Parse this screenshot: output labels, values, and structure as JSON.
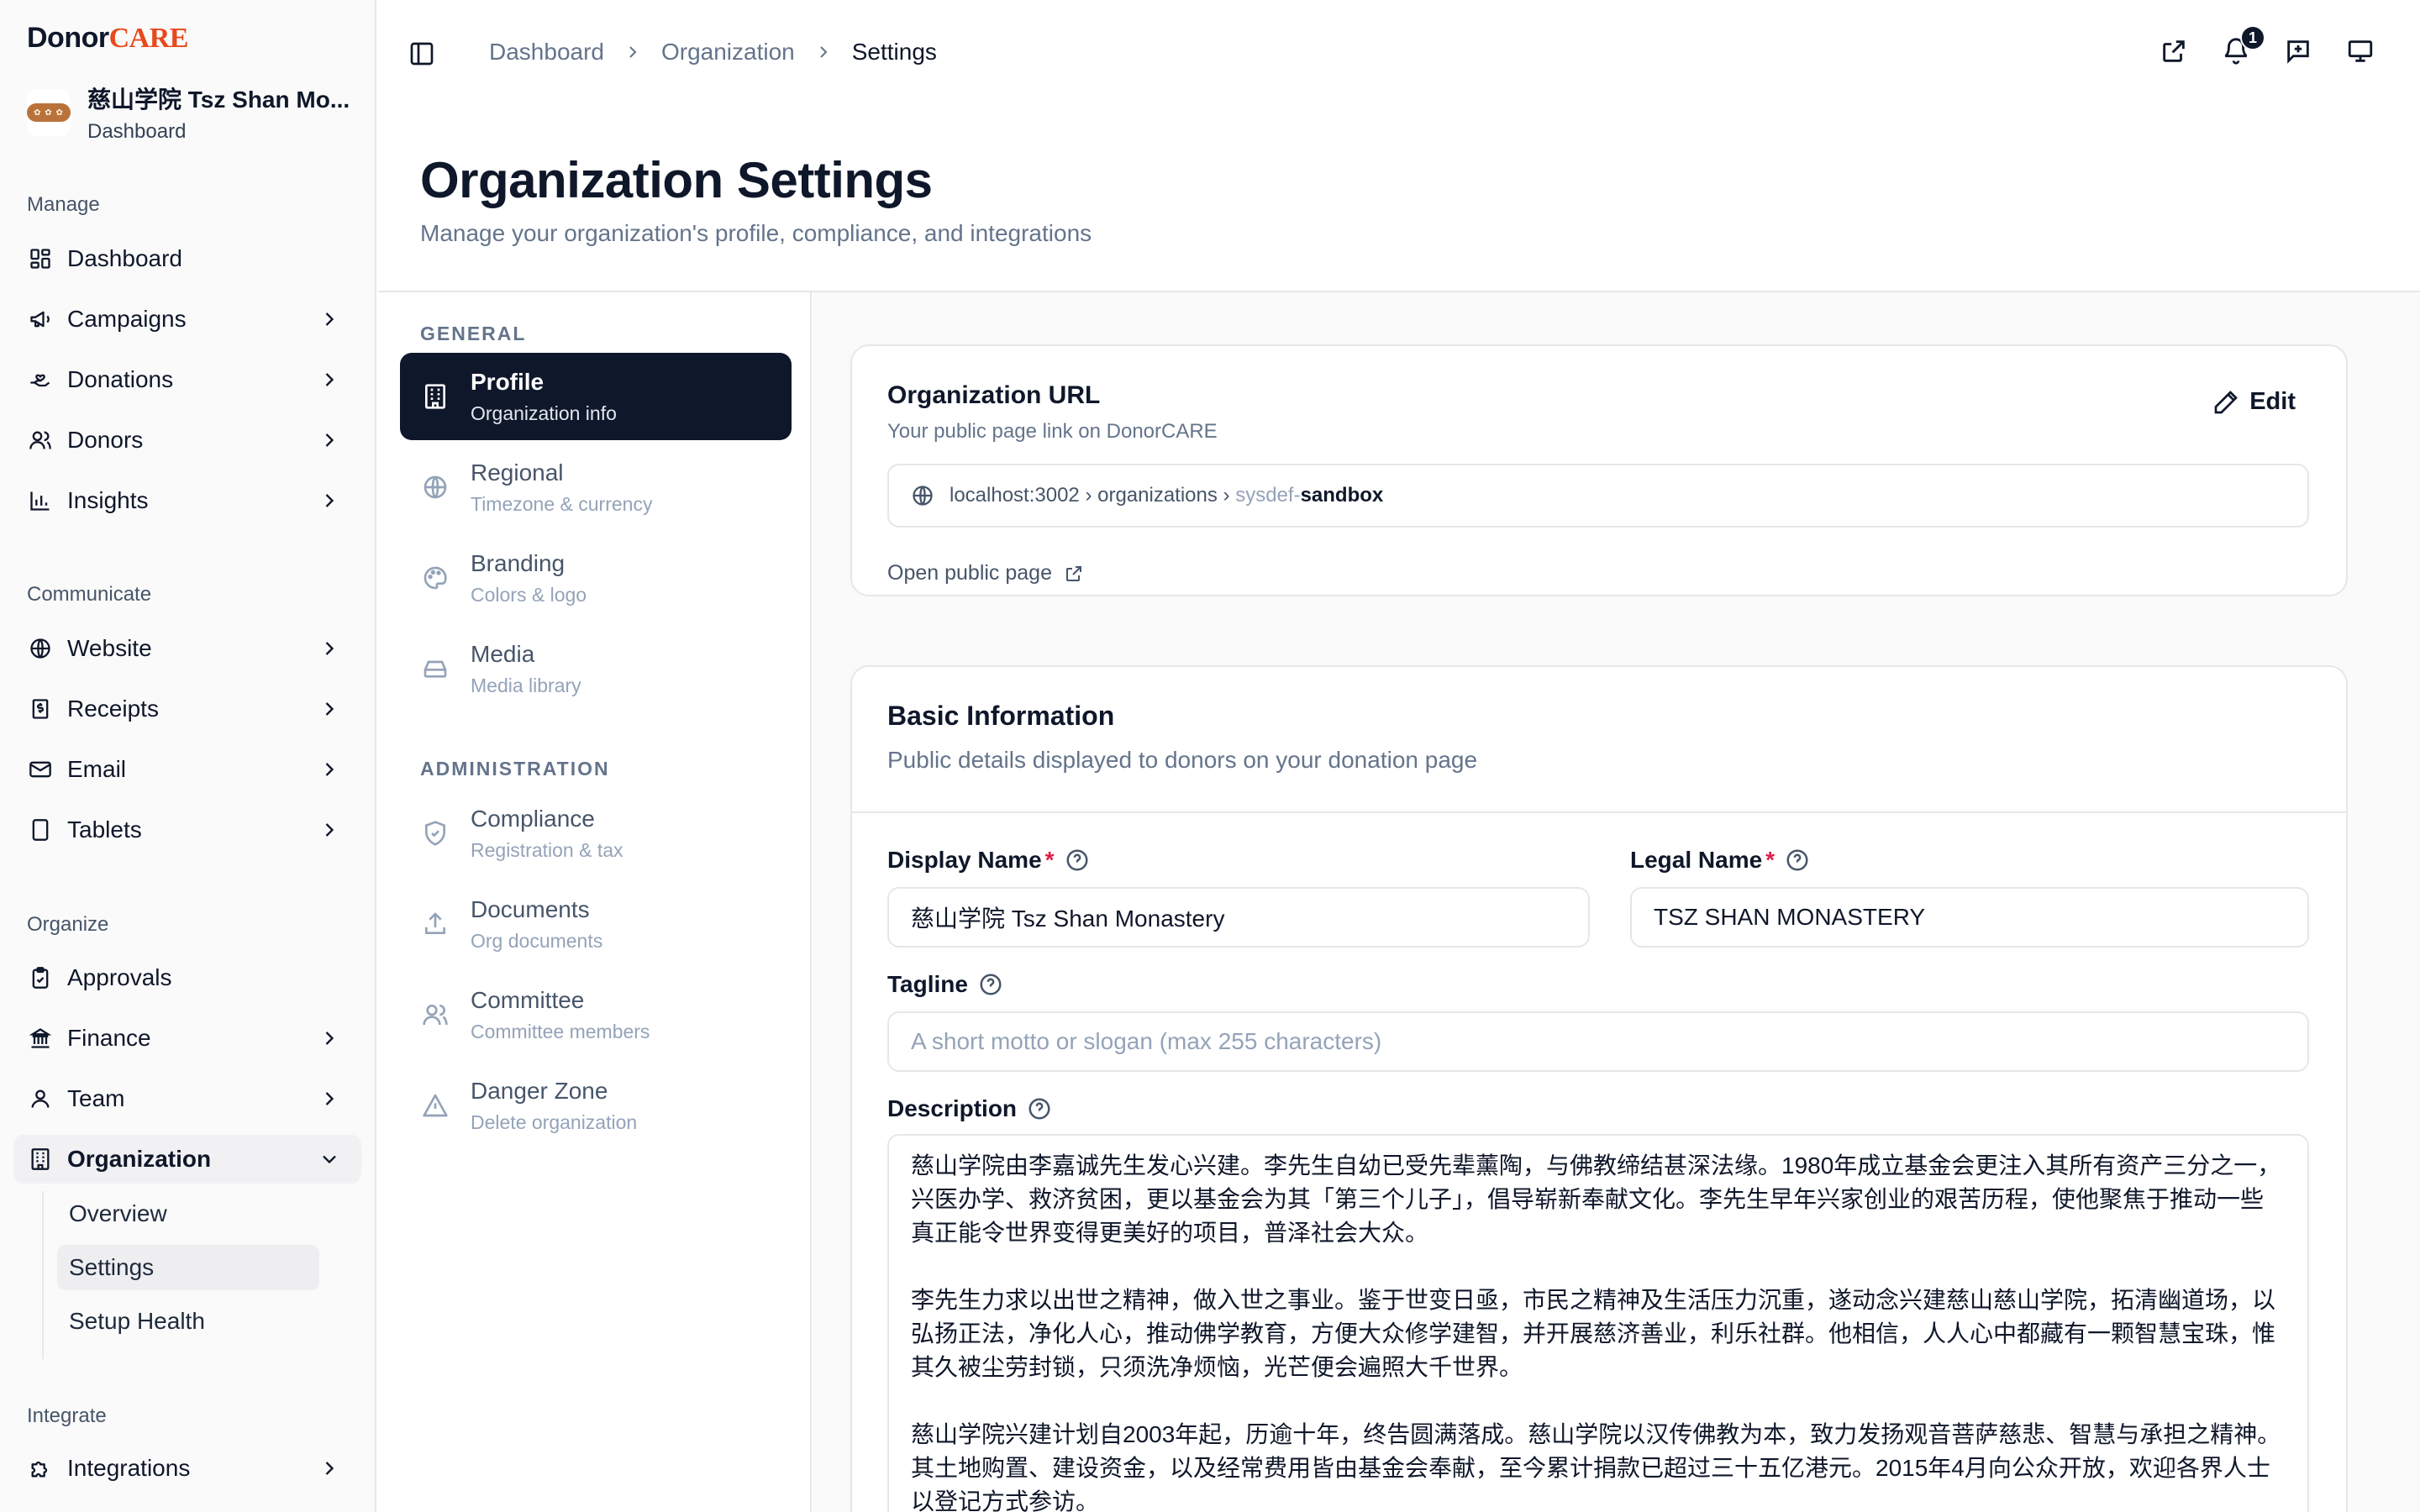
{
  "brand": {
    "donor": "Donor",
    "care": "CARE",
    "accent": "#e8491d"
  },
  "org": {
    "name": "慈山学院 Tsz Shan Mo...",
    "context": "Dashboard"
  },
  "sidebar": {
    "sections": {
      "manage": "Manage",
      "communicate": "Communicate",
      "organize": "Organize",
      "integrate": "Integrate"
    },
    "items": {
      "dashboard": "Dashboard",
      "campaigns": "Campaigns",
      "donations": "Donations",
      "donors": "Donors",
      "insights": "Insights",
      "website": "Website",
      "receipts": "Receipts",
      "email": "Email",
      "tablets": "Tablets",
      "approvals": "Approvals",
      "finance": "Finance",
      "team": "Team",
      "organization": "Organization",
      "integrations": "Integrations"
    },
    "organization_sub": [
      "Overview",
      "Settings",
      "Setup Health"
    ]
  },
  "topbar": {
    "breadcrumb": [
      "Dashboard",
      "Organization",
      "Settings"
    ],
    "notification_count": "1"
  },
  "page": {
    "title": "Organization Settings",
    "subtitle": "Manage your organization's profile, compliance, and integrations"
  },
  "settings_nav": {
    "general_label": "GENERAL",
    "admin_label": "ADMINISTRATION",
    "items": [
      {
        "title": "Profile",
        "desc": "Organization info"
      },
      {
        "title": "Regional",
        "desc": "Timezone & currency"
      },
      {
        "title": "Branding",
        "desc": "Colors & logo"
      },
      {
        "title": "Media",
        "desc": "Media library"
      },
      {
        "title": "Compliance",
        "desc": "Registration & tax"
      },
      {
        "title": "Documents",
        "desc": "Org documents"
      },
      {
        "title": "Committee",
        "desc": "Committee members"
      },
      {
        "title": "Danger Zone",
        "desc": "Delete organization"
      }
    ]
  },
  "org_url": {
    "title": "Organization URL",
    "subtitle": "Your public page link on DonorCARE",
    "edit_label": "Edit",
    "url_prefix": "localhost:3002 › organizations › ",
    "slug_prefix": "sysdef-",
    "slug": "sandbox",
    "open_label": "Open public page"
  },
  "basic_info": {
    "title": "Basic Information",
    "subtitle": "Public details displayed to donors on your donation page",
    "display_name_label": "Display Name",
    "display_name_value": "慈山学院 Tsz Shan Monastery",
    "legal_name_label": "Legal Name",
    "legal_name_value": "TSZ SHAN MONASTERY",
    "tagline_label": "Tagline",
    "tagline_placeholder": "A short motto or slogan (max 255 characters)",
    "description_label": "Description",
    "description_paragraphs": [
      "慈山学院由李嘉诚先生发心兴建。李先生自幼已受先辈薰陶，与佛教缔结甚深法缘。1980年成立基金会更注入其所有资产三分之一，兴医办学、救济贫困，更以基金会为其「第三个儿子」，倡导崭新奉献文化。李先生早年兴家创业的艰苦历程，使他聚焦于推动一些真正能令世界变得更美好的项目，普泽社会大众。",
      "李先生力求以出世之精神，做入世之事业。鉴于世变日亟，市民之精神及生活压力沉重，遂动念兴建慈山慈山学院，拓清幽道场，以弘扬正法，净化人心，推动佛学教育，方便大众修学建智，并开展慈济善业，利乐社群。他相信，人人心中都藏有一颗智慧宝珠，惟其久被尘劳封锁，只须洗净烦恼，光芒便会遍照大千世界。",
      "慈山学院兴建计划自2003年起，历逾十年，终告圆满落成。慈山学院以汉传佛教为本，致力发扬观音菩萨慈悲、智慧与承担之精神。其土地购置、建设资金，以及经常费用皆由基金会奉献，至今累计捐款已超过三十五亿港元。2015年4月向公众开放，欢迎各界人士以登记方式参访。"
    ]
  }
}
